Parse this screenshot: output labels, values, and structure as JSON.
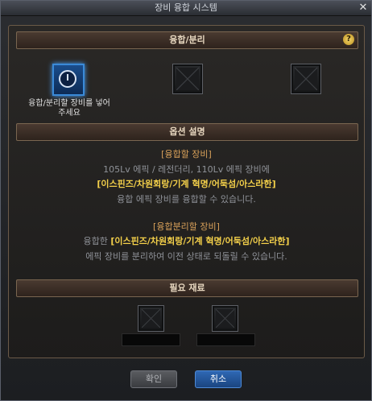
{
  "window": {
    "title": "장비 융합 시스템",
    "close": "✕"
  },
  "fusion_section": {
    "header": "융합/분리",
    "help": "?",
    "slot_caption_line1": "융합/분리할 장비를 넣어",
    "slot_caption_line2": "주세요"
  },
  "options_section": {
    "header": "옵션 설명",
    "fusion_title": "[융합할 장비]",
    "fusion_line1": "105Lv 에픽 / 레전더리, 110Lv 에픽 장비에",
    "fusion_line2": "[이스핀즈/차원회랑/기계 혁명/어둑섬/아스라한]",
    "fusion_line3": "융합 에픽 장비를 융합할 수 있습니다.",
    "split_title": "[융합분리할 장비]",
    "split_line1_prefix": "융합한 ",
    "split_line1_highlight": "[이스핀즈/차원회랑/기계 혁명/어둑섬/아스라한]",
    "split_line2": "에픽 장비를 분리하여 이전 상태로 되돌릴 수 있습니다."
  },
  "materials_section": {
    "header": "필요 재료"
  },
  "buttons": {
    "confirm": "확인",
    "cancel": "취소"
  },
  "colors": {
    "accent_blue": "#2f68b4",
    "highlight_yellow": "#f4d04a",
    "title_orange": "#d9a15a"
  }
}
